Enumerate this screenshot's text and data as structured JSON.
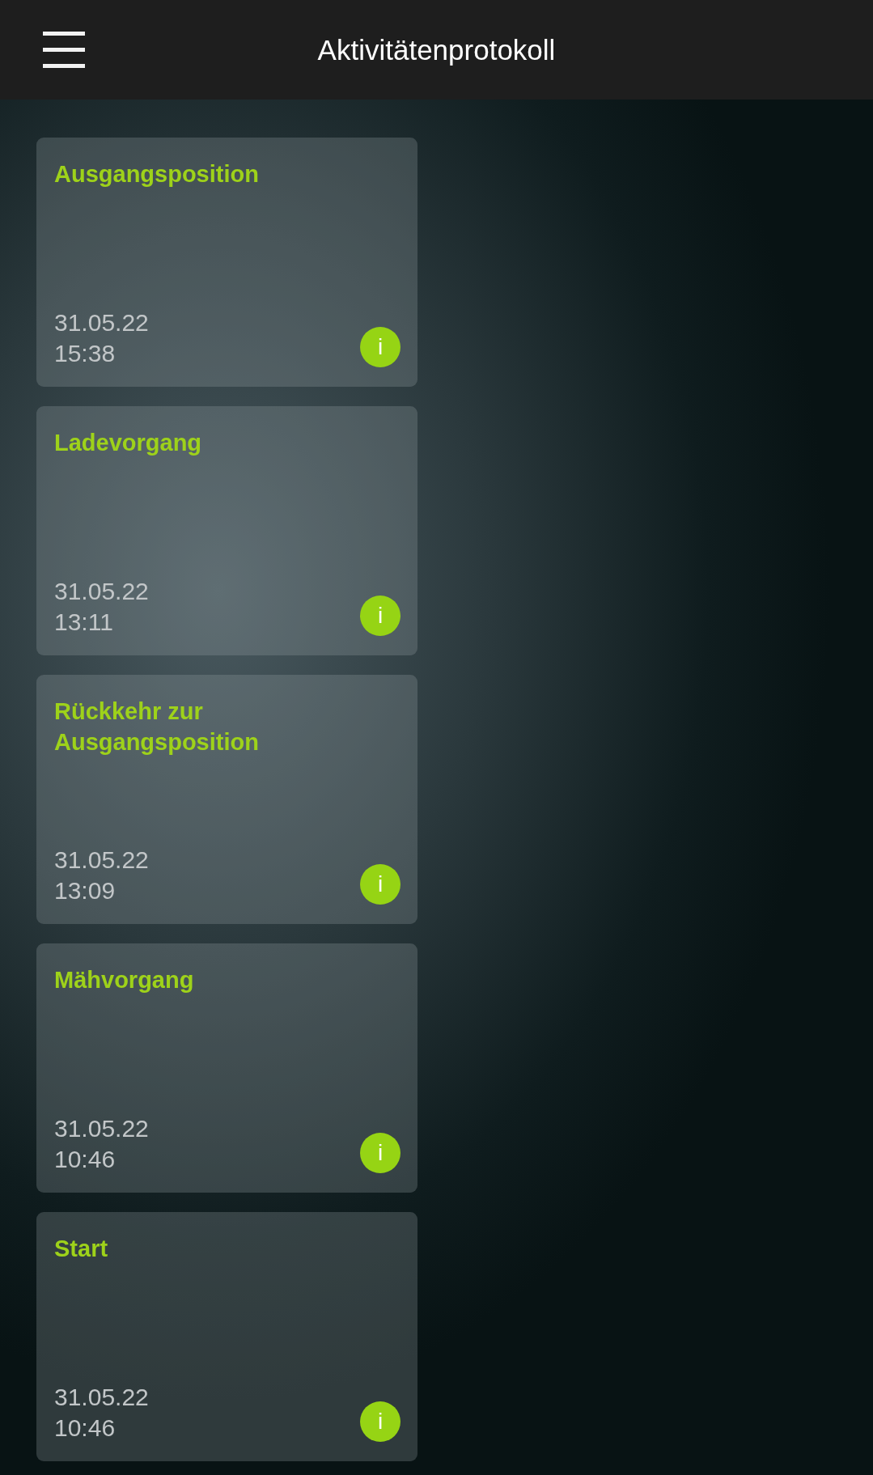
{
  "app_bar": {
    "title": "Aktivitätenprotokoll"
  },
  "entries": [
    {
      "title": "Ausgangsposition",
      "date": "31.05.22",
      "time": "15:38",
      "info": "i"
    },
    {
      "title": "Ladevorgang",
      "date": "31.05.22",
      "time": "13:11",
      "info": "i"
    },
    {
      "title": "Rückkehr zur Ausgangsposition",
      "date": "31.05.22",
      "time": "13:09",
      "info": "i"
    },
    {
      "title": "Mähvorgang",
      "date": "31.05.22",
      "time": "10:46",
      "info": "i"
    },
    {
      "title": "Start",
      "date": "31.05.22",
      "time": "10:46",
      "info": "i"
    }
  ]
}
